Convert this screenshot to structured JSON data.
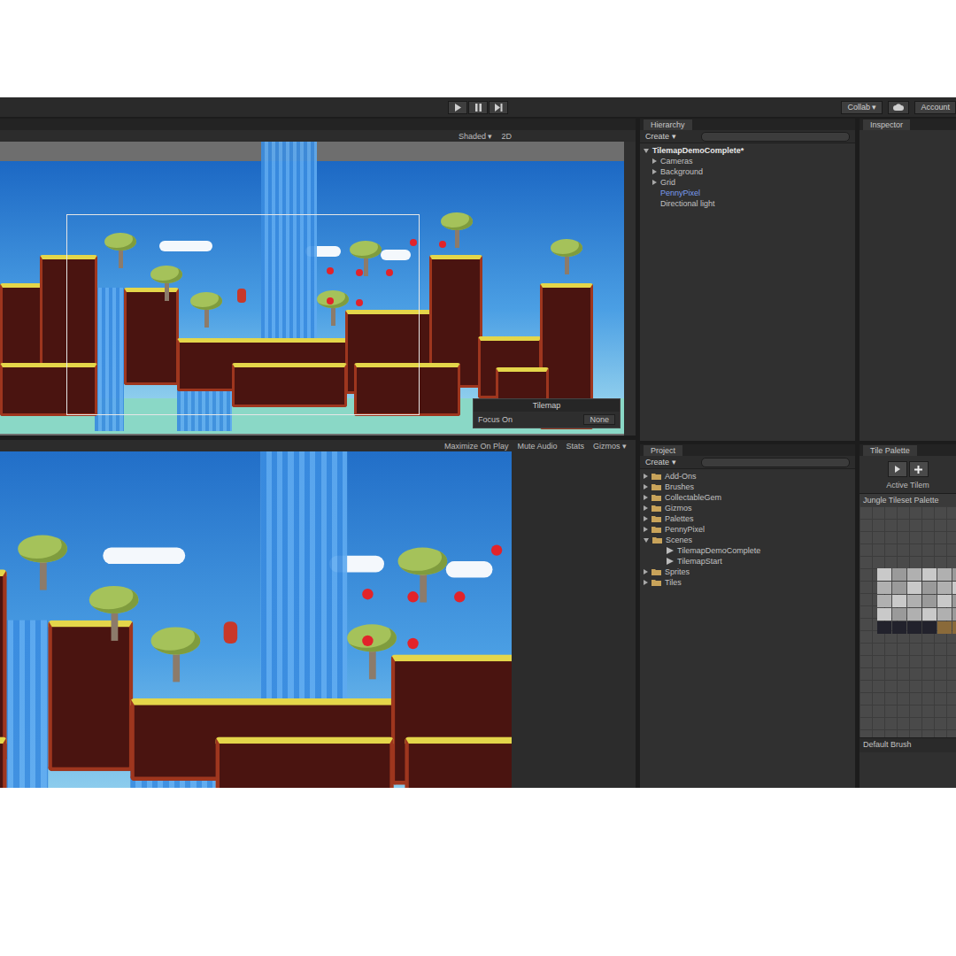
{
  "toolbar": {
    "collab": "Collab ▾",
    "account": "Account"
  },
  "scene_view": {
    "shading": "Shaded ▾",
    "mode": "2D",
    "overlay": {
      "title": "Tilemap",
      "label": "Focus On",
      "value": "None"
    }
  },
  "game_view": {
    "options": [
      "Maximize On Play",
      "Mute Audio",
      "Stats",
      "Gizmos ▾"
    ]
  },
  "hierarchy": {
    "title": "Hierarchy",
    "create": "Create ▾",
    "scene": {
      "label": "TilemapDemoComplete*",
      "expanded": true
    },
    "items": [
      {
        "label": "Cameras",
        "kind": "group",
        "expanded": false
      },
      {
        "label": "Background",
        "kind": "group",
        "expanded": false
      },
      {
        "label": "Grid",
        "kind": "group",
        "expanded": false
      },
      {
        "label": "PennyPixel",
        "kind": "prefab",
        "expanded": false
      },
      {
        "label": "Directional light",
        "kind": "object",
        "expanded": false
      }
    ]
  },
  "inspector": {
    "title": "Inspector"
  },
  "project": {
    "title": "Project",
    "create": "Create ▾",
    "folders": [
      {
        "label": "Add-Ons",
        "expanded": false,
        "children": []
      },
      {
        "label": "Brushes",
        "expanded": false,
        "children": []
      },
      {
        "label": "CollectableGem",
        "expanded": false,
        "children": []
      },
      {
        "label": "Gizmos",
        "expanded": false,
        "children": []
      },
      {
        "label": "Palettes",
        "expanded": false,
        "children": []
      },
      {
        "label": "PennyPixel",
        "expanded": false,
        "children": []
      },
      {
        "label": "Scenes",
        "expanded": true,
        "children": [
          "TilemapDemoComplete",
          "TilemapStart"
        ]
      },
      {
        "label": "Sprites",
        "expanded": false,
        "children": []
      },
      {
        "label": "Tiles",
        "expanded": false,
        "children": []
      }
    ]
  },
  "tile_palette": {
    "title": "Tile Palette",
    "active": "Active Tilem",
    "palette": "Jungle Tileset Palette",
    "brush": "Default Brush"
  }
}
